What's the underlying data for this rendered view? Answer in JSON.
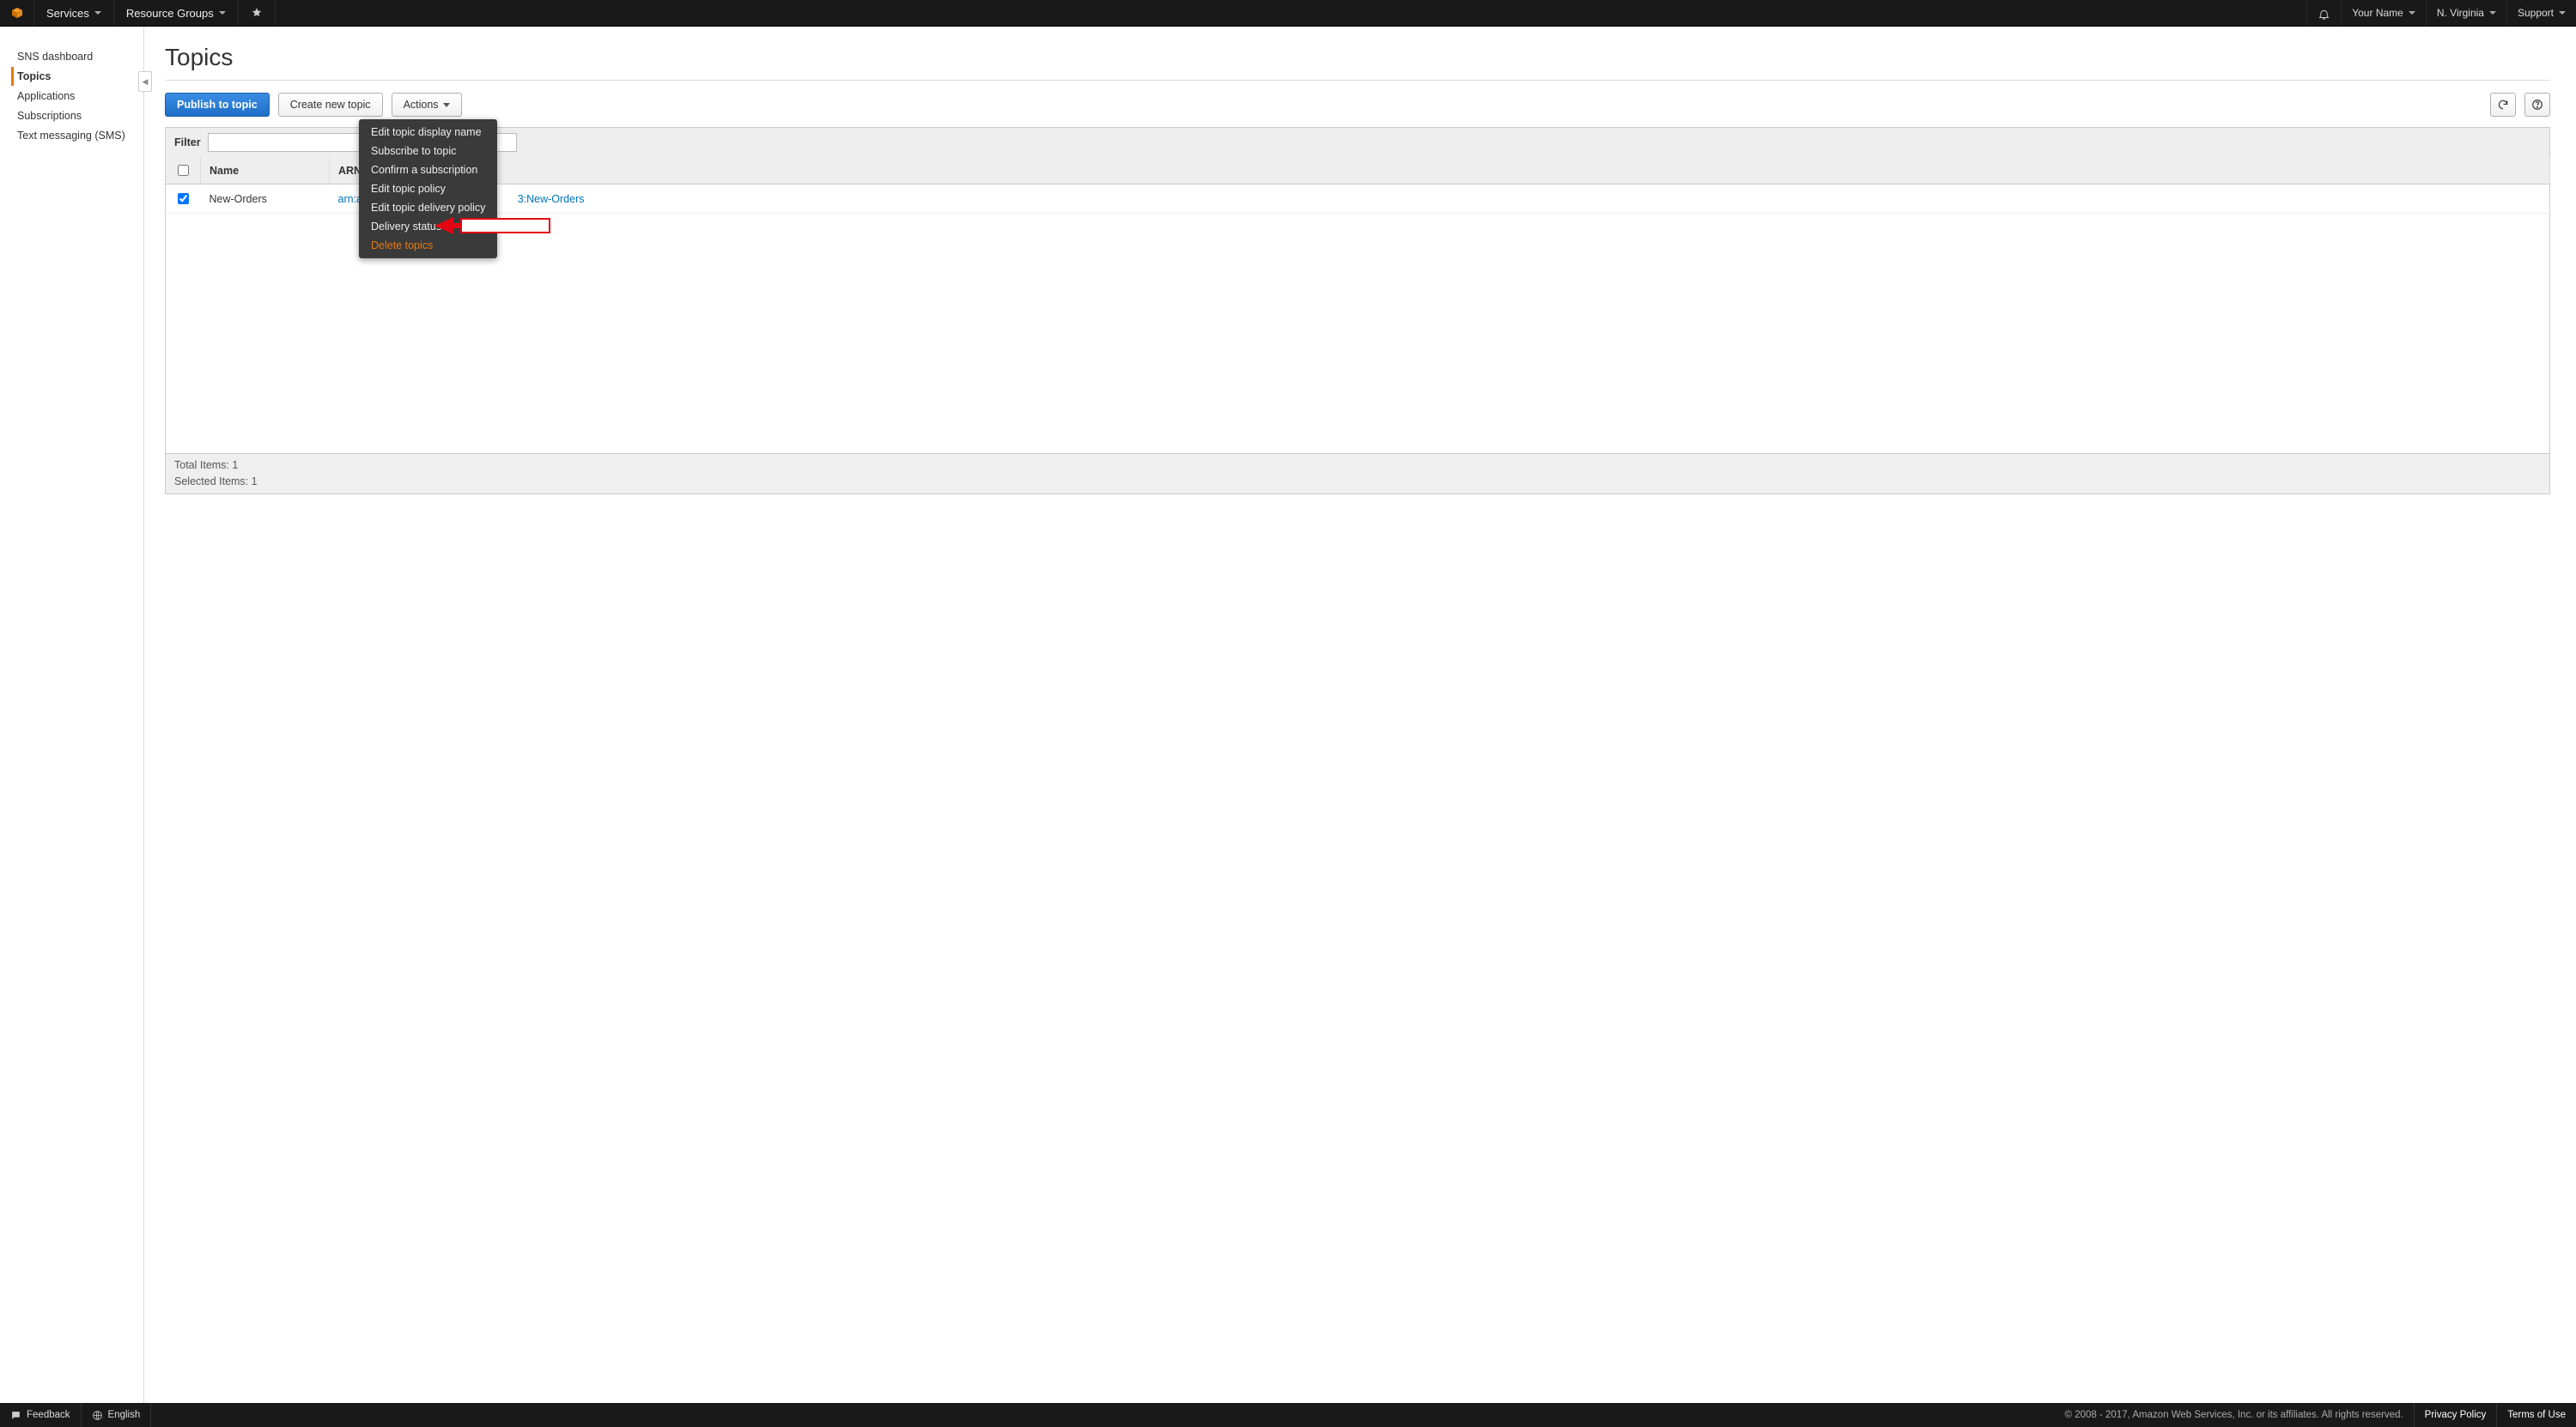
{
  "topnav": {
    "services": "Services",
    "resource_groups": "Resource Groups",
    "user": "Your Name",
    "region": "N. Virginia",
    "support": "Support"
  },
  "sidebar": {
    "items": [
      {
        "label": "SNS dashboard",
        "active": false
      },
      {
        "label": "Topics",
        "active": true
      },
      {
        "label": "Applications",
        "active": false
      },
      {
        "label": "Subscriptions",
        "active": false
      },
      {
        "label": "Text messaging (SMS)",
        "active": false
      }
    ]
  },
  "page": {
    "title": "Topics"
  },
  "buttons": {
    "publish": "Publish to topic",
    "create": "Create new topic",
    "actions": "Actions"
  },
  "actions_menu": [
    {
      "label": "Edit topic display name",
      "highlight": false
    },
    {
      "label": "Subscribe to topic",
      "highlight": false
    },
    {
      "label": "Confirm a subscription",
      "highlight": false
    },
    {
      "label": "Edit topic policy",
      "highlight": false
    },
    {
      "label": "Edit topic delivery policy",
      "highlight": false
    },
    {
      "label": "Delivery status",
      "highlight": false
    },
    {
      "label": "Delete topics",
      "highlight": true
    }
  ],
  "filter": {
    "label": "Filter",
    "value": ""
  },
  "table": {
    "columns": {
      "name": "Name",
      "arn": "ARN"
    },
    "rows": [
      {
        "checked": true,
        "name": "New-Orders",
        "arn_left": "arn:aws",
        "arn_right": "3:New-Orders"
      }
    ]
  },
  "status": {
    "total_label": "Total Items:",
    "total_value": "1",
    "selected_label": "Selected Items:",
    "selected_value": "1"
  },
  "footer": {
    "feedback": "Feedback",
    "language": "English",
    "copyright": "© 2008 - 2017, Amazon Web Services, Inc. or its affiliates. All rights reserved.",
    "privacy": "Privacy Policy",
    "terms": "Terms of Use"
  }
}
